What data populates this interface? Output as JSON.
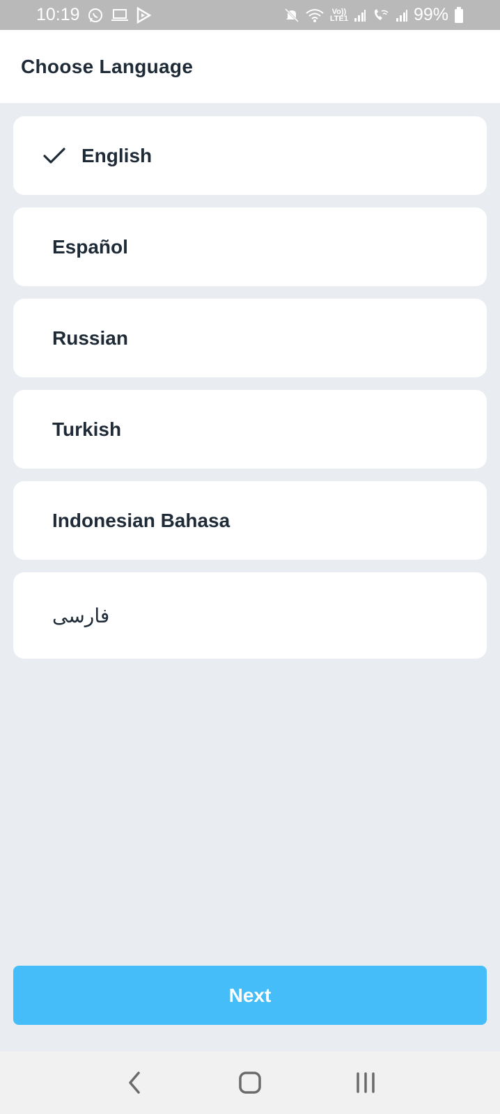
{
  "status_bar": {
    "time": "10:19",
    "battery": "99%",
    "left_icons": [
      "whatsapp-icon",
      "laptop-icon",
      "play-icon"
    ],
    "right_icons": [
      "mute-icon",
      "wifi-icon",
      "volte-lte-icon",
      "signal-icon",
      "wifi-call-icon",
      "signal-icon",
      "battery-icon"
    ],
    "volte_top": "Vo))",
    "volte_bottom": "LTE1"
  },
  "header": {
    "title": "Choose Language"
  },
  "languages": [
    {
      "label": "English",
      "selected": true
    },
    {
      "label": "Español",
      "selected": false
    },
    {
      "label": "Russian",
      "selected": false
    },
    {
      "label": "Turkish",
      "selected": false
    },
    {
      "label": "Indonesian Bahasa",
      "selected": false
    },
    {
      "label": "فارسی",
      "selected": false
    }
  ],
  "next_button": {
    "label": "Next"
  },
  "nav_bar": {
    "icons": [
      "back-icon",
      "home-icon",
      "recents-icon"
    ]
  },
  "colors": {
    "accent": "#45bdf8",
    "background": "#e9edf1",
    "text": "#1f2a37"
  }
}
